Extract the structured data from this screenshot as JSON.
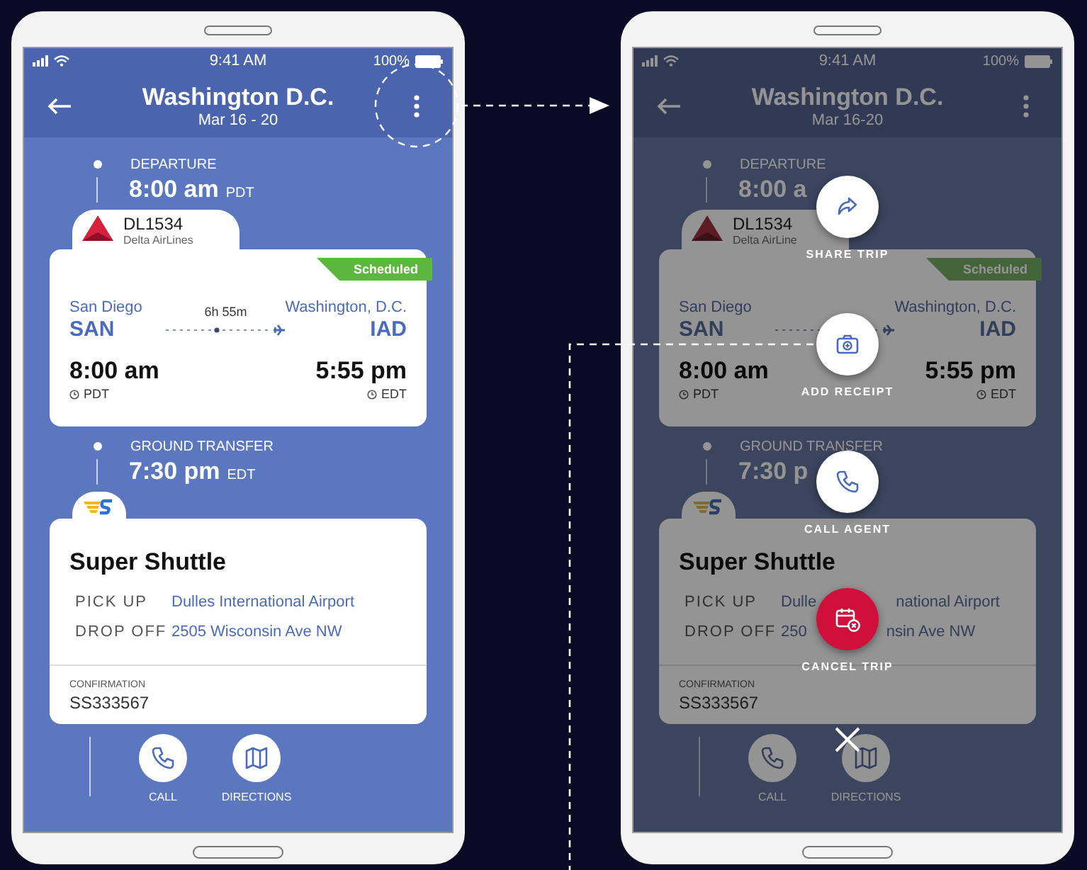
{
  "phones": [
    {
      "dimmed": false,
      "status_bar": {
        "time": "9:41 AM",
        "battery": "100%"
      },
      "header": {
        "title": "Washington D.C.",
        "subtitle": "Mar 16 - 20"
      },
      "legs": [
        {
          "kind": "flight",
          "label": "DEPARTURE",
          "time": "8:00 am",
          "zone": "PDT",
          "card": {
            "flight": "DL1534",
            "airline": "Delta AirLines",
            "status": "Scheduled",
            "from_city": "San Diego",
            "from_code": "SAN",
            "duration": "6h 55m",
            "to_city": "Washington, D.C.",
            "to_code": "IAD",
            "depart_time": "8:00 am",
            "depart_zone": "PDT",
            "arrive_time": "5:55 pm",
            "arrive_zone": "EDT"
          }
        },
        {
          "kind": "ground",
          "label": "GROUND TRANSFER",
          "time": "7:30 pm",
          "zone": "EDT",
          "card": {
            "company": "Super Shuttle",
            "rows": [
              {
                "label": "PICK UP",
                "value": "Dulles International Airport"
              },
              {
                "label": "DROP OFF",
                "value": "2505 Wisconsin Ave NW"
              }
            ],
            "confirmation_label": "CONFIRMATION",
            "confirmation": "SS333567"
          }
        }
      ],
      "actions": [
        {
          "kind": "call",
          "label": "CALL"
        },
        {
          "kind": "directions",
          "label": "DIRECTIONS"
        }
      ]
    },
    {
      "dimmed": true,
      "status_bar": {
        "time": "9:41 AM",
        "battery": "100%"
      },
      "header": {
        "title": "Washington D.C.",
        "subtitle": "Mar 16-20"
      },
      "legs": [
        {
          "kind": "flight",
          "label": "DEPARTURE",
          "time": "8:00 a",
          "card": {
            "flight": "DL1534",
            "airline": "Delta AirLine",
            "status": "Scheduled",
            "from_city": "San Diego",
            "from_code": "SAN",
            "to_city": "Washington, D.C.",
            "to_code": "IAD",
            "depart_time": "8:00 am",
            "depart_zone": "PDT",
            "arrive_time": "5:55 pm",
            "arrive_zone": "EDT"
          }
        },
        {
          "kind": "ground",
          "label": "GROUND TRANSFER",
          "time": "7:30 p",
          "card": {
            "company": "Super Shuttle",
            "rows": [
              {
                "label": "PICK UP",
                "value": [
                  "Dulle",
                  "national Airport"
                ]
              },
              {
                "label": "DROP OFF",
                "value": [
                  "250",
                  "nsin Ave NW"
                ]
              }
            ],
            "confirmation_label": "CONFIRMATION",
            "confirmation": "SS333567"
          }
        }
      ],
      "actions": [
        {
          "kind": "call",
          "label": "CALL"
        },
        {
          "kind": "directions",
          "label": "DIRECTIONS"
        }
      ],
      "action_menu": {
        "items": [
          {
            "kind": "share",
            "label": "SHARE TRIP"
          },
          {
            "kind": "receipt",
            "label": "ADD RECEIPT"
          },
          {
            "kind": "call",
            "label": "CALL AGENT"
          },
          {
            "kind": "cancel",
            "label": "CANCEL TRIP"
          }
        ],
        "close": true
      }
    }
  ]
}
